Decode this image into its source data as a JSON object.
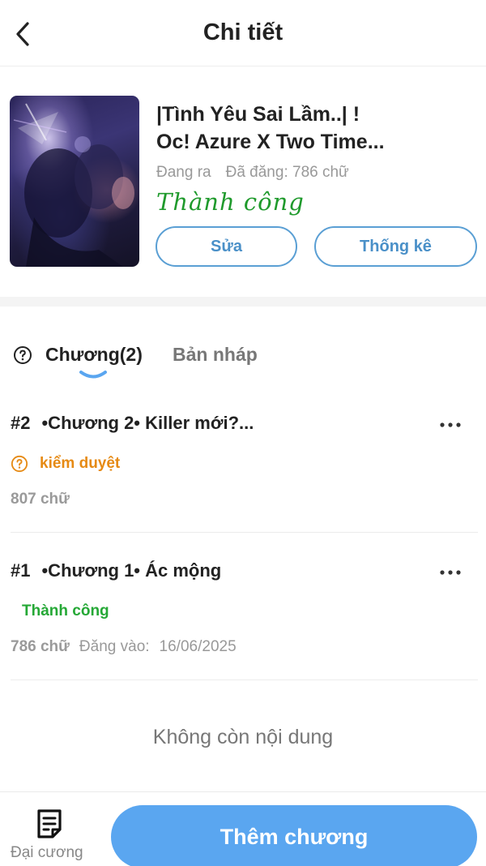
{
  "header": {
    "title": "Chi tiết",
    "back_icon": "chevron-left-icon"
  },
  "book": {
    "title_line1": "|Tình Yêu Sai Lầm..| !",
    "title_line2": "Oc! Azure X Two Time...",
    "status": "Đang ra",
    "published_words": "Đã đăng: 786 chữ",
    "approval": "Thành công",
    "edit_label": "Sửa",
    "stats_label": "Thống kê"
  },
  "tabs": {
    "help_icon": "question-circle-icon",
    "chapters_label": "Chương(2)",
    "drafts_label": "Bản nháp"
  },
  "chapters": [
    {
      "number": "#2",
      "title": "•Chương 2• Killer mới?...",
      "status": "kiểm duyệt",
      "status_color": "#e68a14",
      "words": "807 chữ"
    },
    {
      "number": "#1",
      "title": "•Chương 1• Ác mộng",
      "status": "Thành công",
      "status_color": "#25a836",
      "words": "786 chữ",
      "posted_label": "Đăng vào:",
      "posted_date": "16/06/2025"
    }
  ],
  "end_text": "Không còn nội dung",
  "bottom": {
    "outline_label": "Đại cương",
    "outline_icon": "document-list-icon",
    "add_label": "Thêm chương"
  },
  "colors": {
    "accent": "#5aa6f0",
    "outline_blue": "#5a9fd4",
    "success": "#25a836",
    "review": "#e68a14"
  }
}
